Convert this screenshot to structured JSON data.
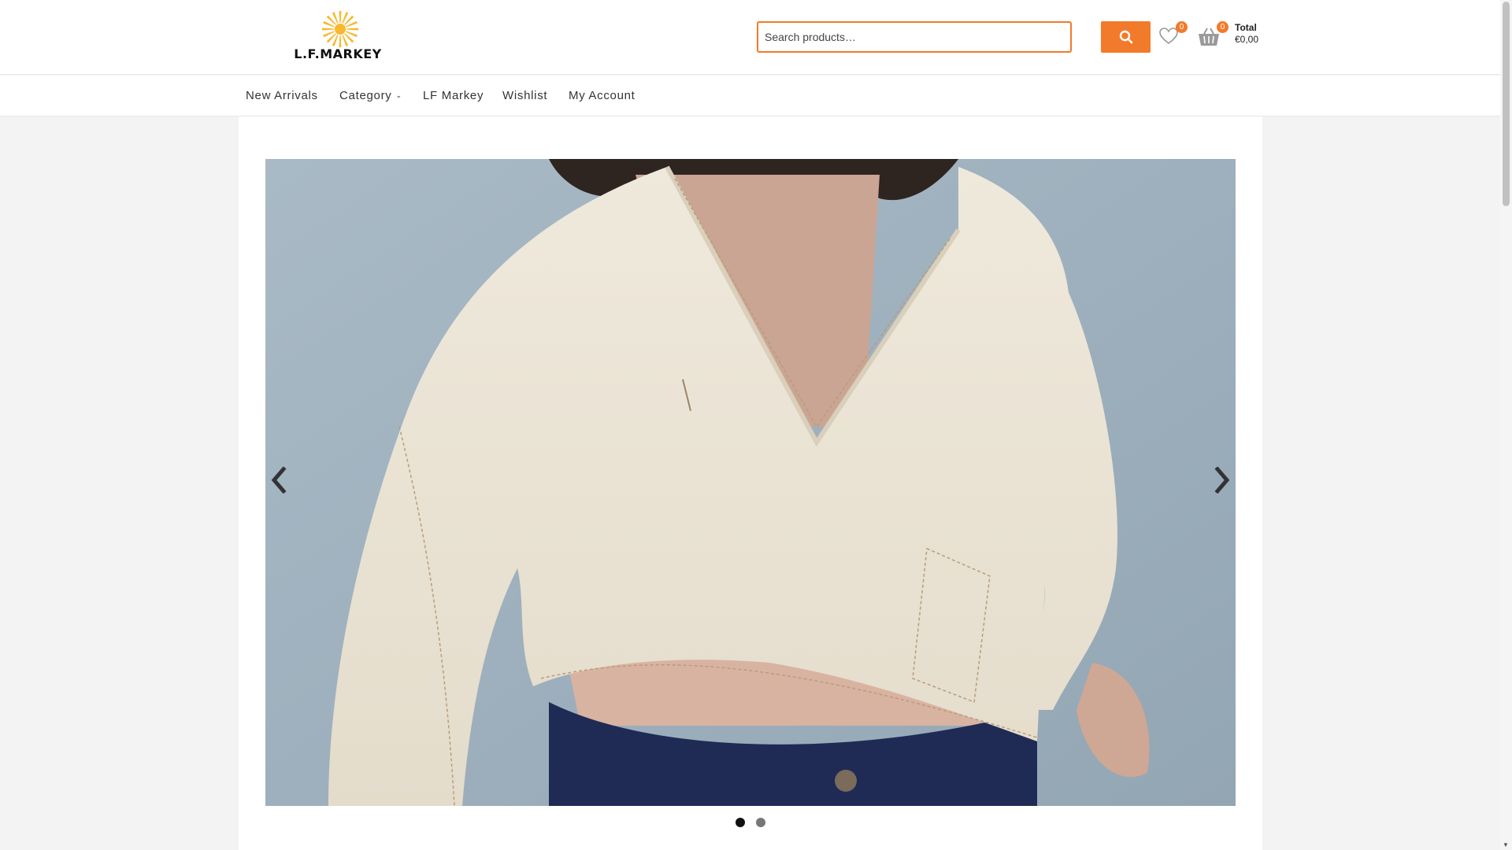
{
  "brand": {
    "logo_text": "L.F.MARKEY",
    "accent_color": "#f27a2b",
    "logo_sun_color": "#f9b82d"
  },
  "search": {
    "placeholder": "Search products…",
    "value": ""
  },
  "header": {
    "search_button_icon": "search-icon",
    "wishlist": {
      "icon": "heart-icon",
      "count": "0"
    },
    "cart": {
      "icon": "basket-icon",
      "count": "0",
      "total_label": "Total",
      "total_value": "€0,00"
    }
  },
  "nav": {
    "items": [
      {
        "label": "New Arrivals"
      },
      {
        "label": "Category",
        "has_dropdown": true
      },
      {
        "label": "LF Markey"
      },
      {
        "label": "Wishlist"
      },
      {
        "label": "My Account"
      }
    ]
  },
  "slider": {
    "image": "product-photo-cream-cropped-v-neck-top",
    "prev_icon": "chevron-left-icon",
    "next_icon": "chevron-right-icon",
    "slide_count": 2,
    "active_slide": 1
  }
}
